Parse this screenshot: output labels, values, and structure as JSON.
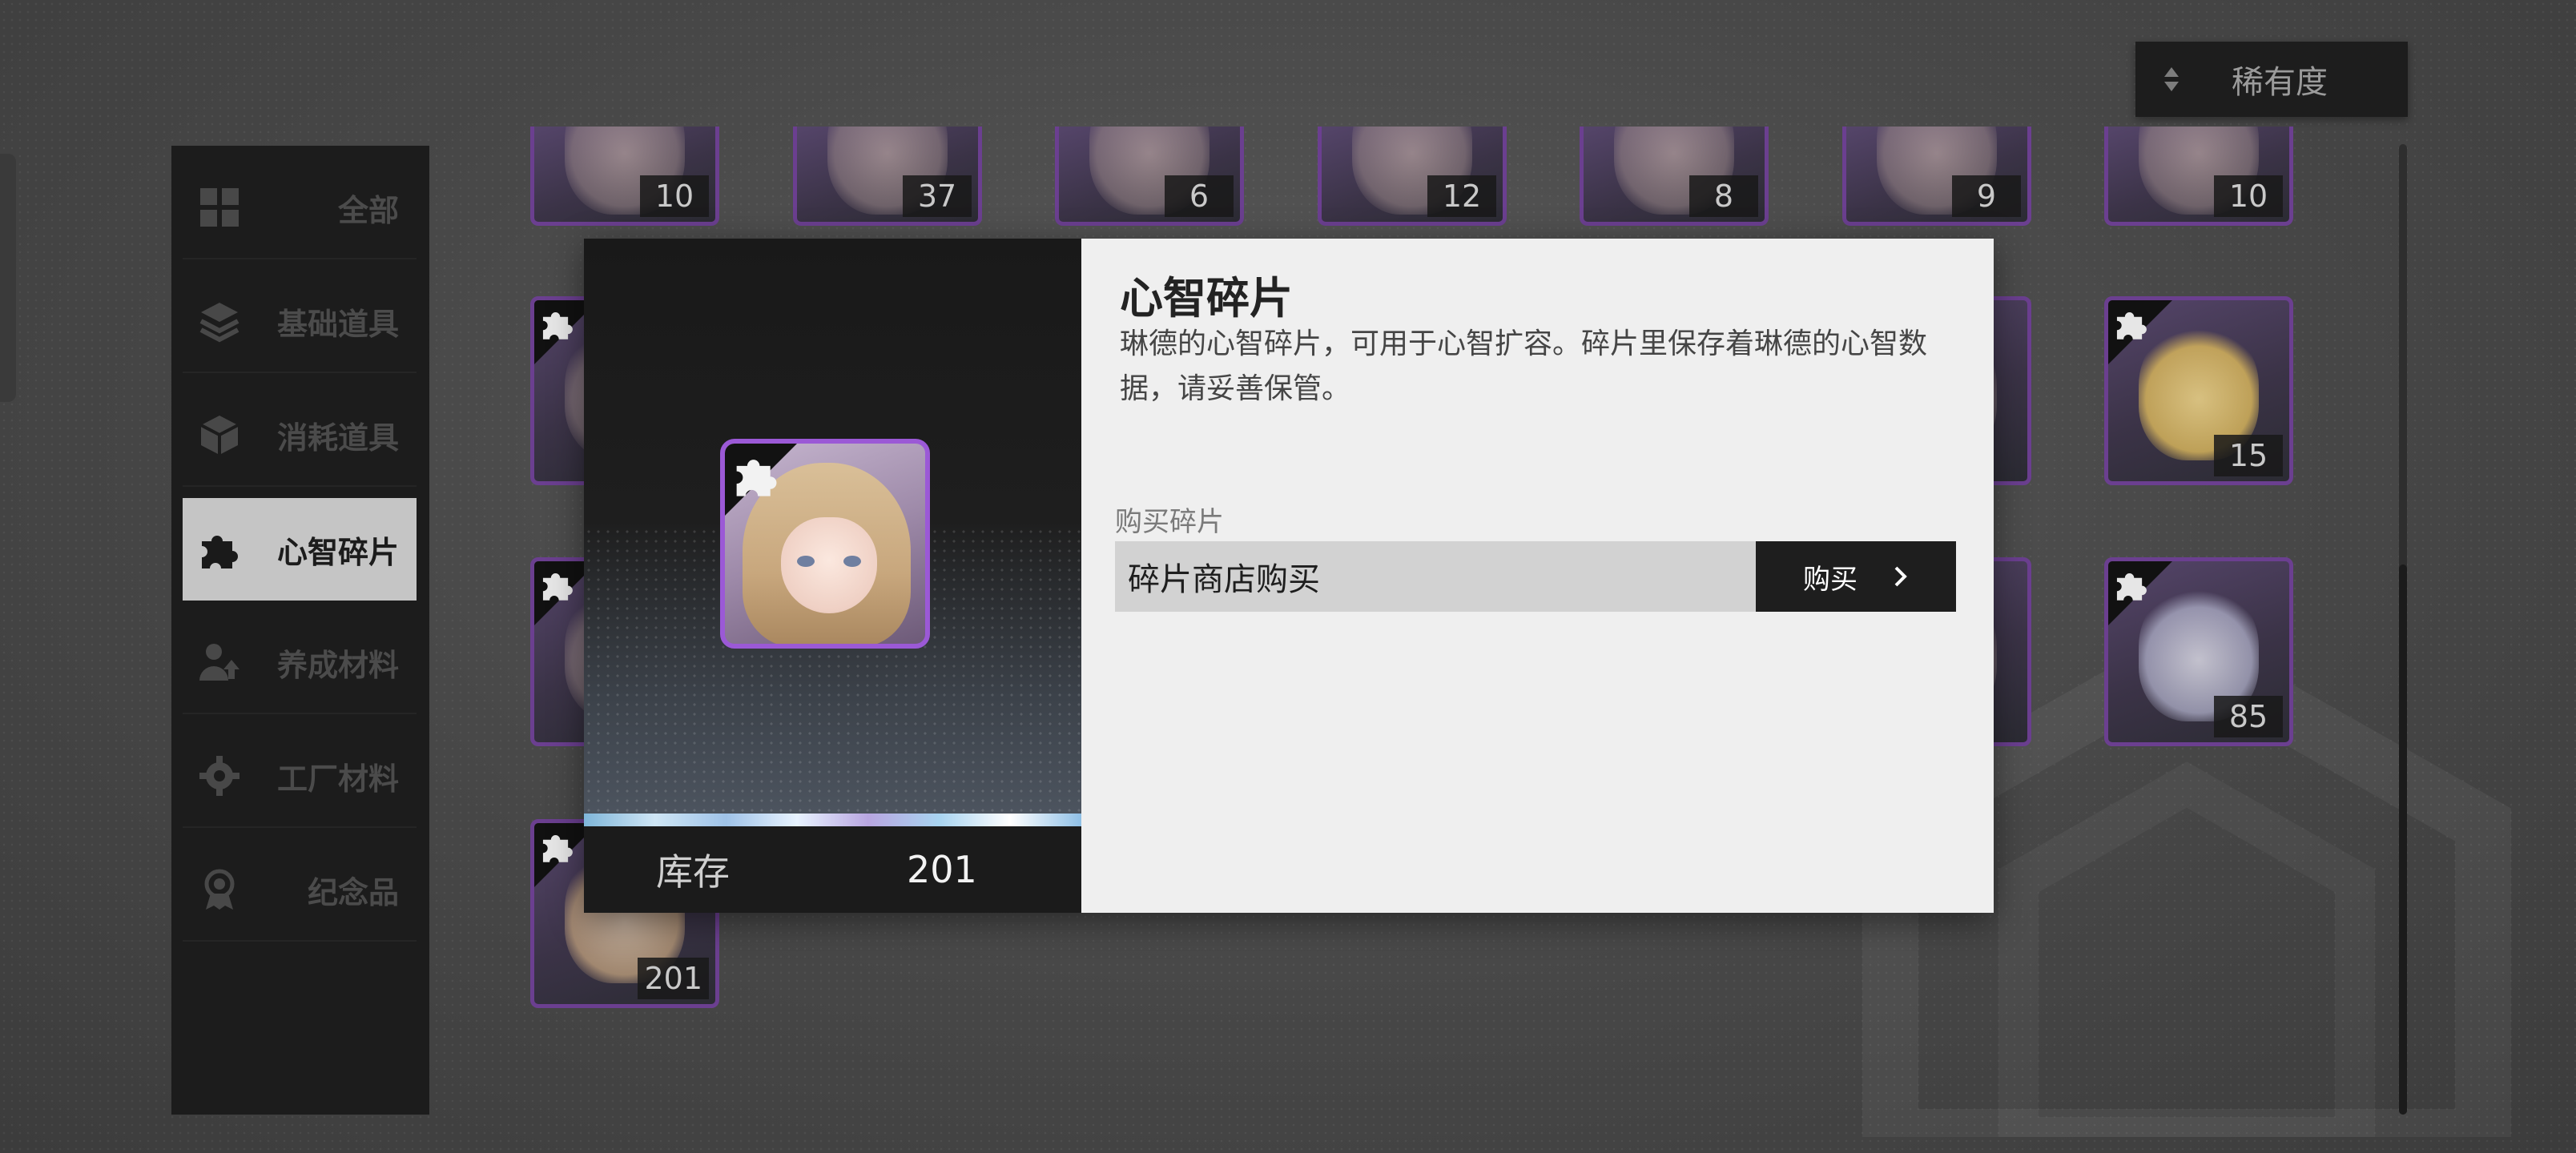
{
  "sort": {
    "label": "稀有度",
    "icon": "sort-arrows-icon"
  },
  "sidebar": {
    "items": [
      {
        "label": "全部",
        "icon": "grid-icon",
        "active": false
      },
      {
        "label": "基础道具",
        "icon": "layers-icon",
        "active": false
      },
      {
        "label": "消耗道具",
        "icon": "cube-icon",
        "active": false
      },
      {
        "label": "心智碎片",
        "icon": "puzzle-icon",
        "active": true
      },
      {
        "label": "养成材料",
        "icon": "person-upgrade-icon",
        "active": false
      },
      {
        "label": "工厂材料",
        "icon": "gear-icon",
        "active": false
      },
      {
        "label": "纪念品",
        "icon": "medal-icon",
        "active": false
      }
    ]
  },
  "grid": {
    "row1_counts": [
      "10",
      "37",
      "6",
      "12",
      "8",
      "9",
      "10"
    ],
    "row2_counts": [
      "15"
    ],
    "row3_counts": [
      "85"
    ],
    "row4_counts": [
      "201"
    ]
  },
  "modal": {
    "title": "心智碎片",
    "description": "琳德的心智碎片，可用于心智扩容。碎片里保存着琳德的心智数据，请妥善保管。",
    "stock_label": "库存",
    "stock_value": "201",
    "buy_section_label": "购买碎片",
    "buy_source": "碎片商店购买",
    "buy_button": "购买",
    "buy_button_icon": "chevron-right-icon"
  },
  "colors": {
    "card_border": "#6b3f90",
    "portrait_border": "#9b59d6",
    "active_tab_bg": "#c5c5c5",
    "buy_button_bg": "#1e1e1e"
  }
}
